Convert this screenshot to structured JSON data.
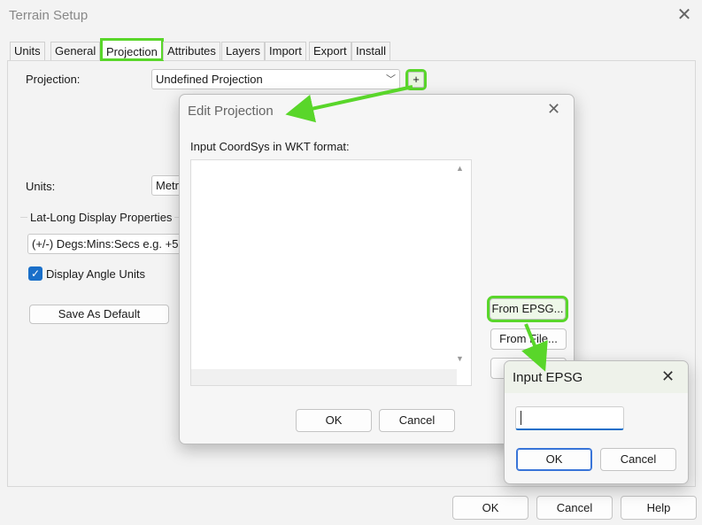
{
  "window": {
    "title": "Terrain Setup"
  },
  "tabs": [
    {
      "label": "Units"
    },
    {
      "label": "General"
    },
    {
      "label": "Projection"
    },
    {
      "label": "Attributes"
    },
    {
      "label": "Layers"
    },
    {
      "label": "Import"
    },
    {
      "label": "Export"
    },
    {
      "label": "Install"
    }
  ],
  "projection": {
    "label": "Projection:",
    "value": "Undefined Projection",
    "add_glyph": "+"
  },
  "units": {
    "label": "Units:",
    "value": "Metr"
  },
  "latlong": {
    "group_label": "Lat-Long Display Properties",
    "format_value": "(+/-) Degs:Mins:Secs e.g. +5",
    "angle_units_label": "Display Angle Units",
    "angle_units_checked": true
  },
  "save_default_label": "Save As Default",
  "footer": {
    "ok_label": "OK",
    "cancel_label": "Cancel",
    "help_label": "Help"
  },
  "edit_projection": {
    "title": "Edit Projection",
    "prompt": "Input CoordSys in WKT format:",
    "wkt_value": "",
    "from_epsg_label": "From EPSG...",
    "from_file_label": "From File...",
    "ok_label": "OK",
    "cancel_label": "Cancel"
  },
  "input_epsg": {
    "title": "Input EPSG",
    "value": "",
    "ok_label": "OK",
    "cancel_label": "Cancel"
  },
  "colors": {
    "highlight": "#59d62a",
    "accent": "#3874d8",
    "check": "#1a6fc9"
  }
}
